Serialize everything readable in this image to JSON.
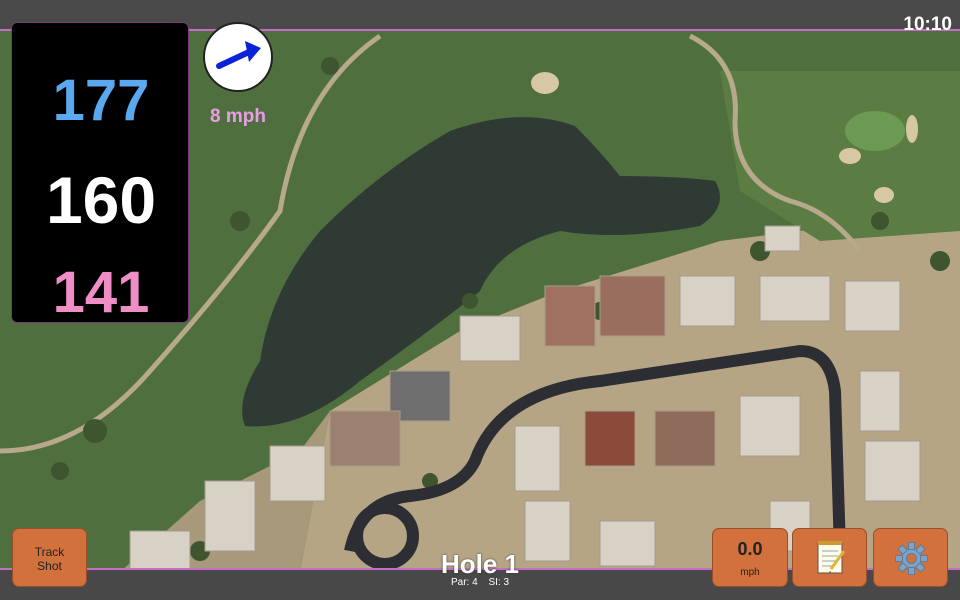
{
  "status": {
    "time": "10:10"
  },
  "distances": {
    "back": "177",
    "middle": "160",
    "front": "141"
  },
  "wind": {
    "speed_text": "8 mph",
    "arrow_icon": "arrow-east-northeast"
  },
  "buttons": {
    "track_shot": {
      "line1": "Track",
      "line2": "Shot"
    },
    "speed": {
      "value": "0.0",
      "unit": "mph"
    },
    "notes_icon": "notepad-icon",
    "settings_icon": "gear-icon"
  },
  "hole": {
    "title": "Hole 1",
    "par": "Par: 4",
    "si": "SI: 3"
  },
  "colors": {
    "back": "#5aa9ee",
    "middle": "#ffffff",
    "front": "#ee8dc6",
    "button": "#d2713c",
    "accent": "#c66ec6",
    "wind_text": "#e99de6"
  }
}
